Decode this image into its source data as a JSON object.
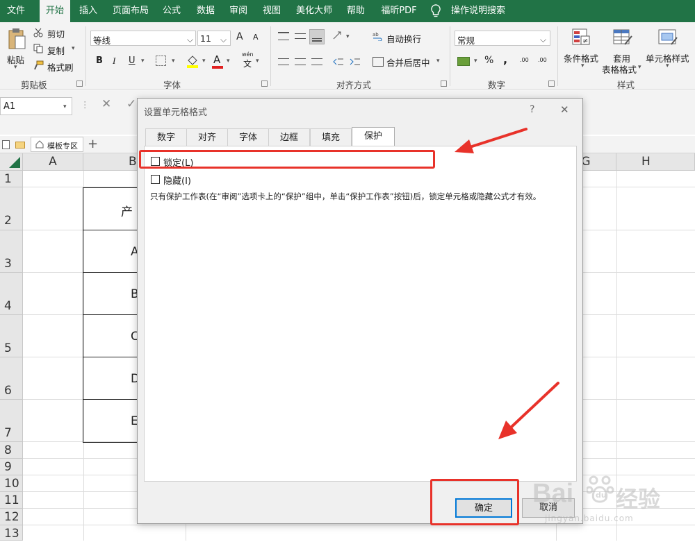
{
  "menu": {
    "items": [
      "文件",
      "开始",
      "插入",
      "页面布局",
      "公式",
      "数据",
      "审阅",
      "视图",
      "美化大师",
      "帮助",
      "福昕PDF",
      "操作说明搜索"
    ]
  },
  "ribbon": {
    "clipboard": {
      "paste": "粘贴",
      "cut": "剪切",
      "copy": "复制",
      "format_painter": "格式刷",
      "label": "剪贴板"
    },
    "font": {
      "name": "等线",
      "size": "11",
      "grow": "A",
      "shrink": "A",
      "bold": "B",
      "italic": "I",
      "underline": "U",
      "font_color": "A",
      "wen": "wén",
      "wen_char": "文",
      "label": "字体"
    },
    "alignment": {
      "wrap": "自动换行",
      "merge": "合并后居中",
      "label": "对齐方式"
    },
    "number": {
      "format": "常规",
      "percent": "%",
      "comma": ",",
      "inc": ".00",
      "label": "数字"
    },
    "styles": {
      "conditional": "条件格式",
      "table1": "套用",
      "table2": "表格格式",
      "cell_styles": "单元格样式",
      "label": "样式"
    }
  },
  "namebox": "A1",
  "sheet_tab": "模板专区",
  "columns": [
    "A",
    "B",
    "G",
    "H"
  ],
  "rows": [
    "1",
    "2",
    "3",
    "4",
    "5",
    "6",
    "7",
    "8",
    "9",
    "10",
    "11",
    "12",
    "13"
  ],
  "cells": [
    "产",
    "A",
    "B",
    "C",
    "D",
    "E"
  ],
  "dialog": {
    "title": "设置单元格格式",
    "help": "?",
    "close": "✕",
    "tabs": [
      "数字",
      "对齐",
      "字体",
      "边框",
      "填充",
      "保护"
    ],
    "locked": "锁定(L)",
    "hidden": "隐藏(I)",
    "note": "只有保护工作表(在“审阅”选项卡上的“保护”组中，单击“保护工作表”按钮)后，锁定单元格或隐藏公式才有效。",
    "ok": "确定",
    "cancel": "取消"
  },
  "watermark": {
    "text": "Bai",
    "text2": "经验",
    "url": "jingyan.baidu.com"
  },
  "colors": {
    "excel_green": "#217346",
    "annotation_red": "#e8322a"
  }
}
